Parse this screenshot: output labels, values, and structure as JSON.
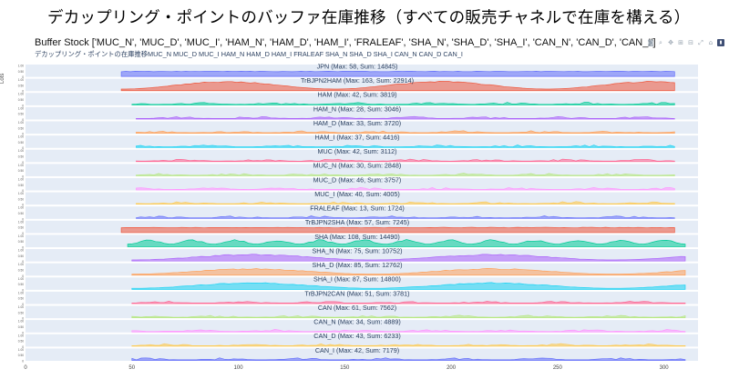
{
  "slide_title": "デカップリング・ポイントのバッファ在庫推移（すべての販売チャネルで在庫を構える）",
  "chart_title": "Buffer Stock ['MUC_N', 'MUC_D', 'MUC_I', 'HAM_N', 'HAM_D', 'HAM_I', 'FRALEAF', 'SHA_N', 'SHA_D', 'SHA_I', 'CAN_N', 'CAN_D', 'CAN_I']",
  "chart_subtitle": "デカップリング・ポイントの在庫推移MUC_N MUC_D MUC_I HAM_N HAM_D HAM_I FRALEAF SHA_N SHA_D SHA_I CAN_N CAN_D CAN_I",
  "ylabel": "Lots",
  "modebar": [
    {
      "name": "camera-icon",
      "glyph": "◙"
    },
    {
      "name": "zoom-icon",
      "glyph": "⌕"
    },
    {
      "name": "pan-icon",
      "glyph": "✥"
    },
    {
      "name": "zoom-in-icon",
      "glyph": "⊞"
    },
    {
      "name": "zoom-out-icon",
      "glyph": "⊟"
    },
    {
      "name": "autoscale-icon",
      "glyph": "⤢"
    },
    {
      "name": "home-icon",
      "glyph": "⌂"
    },
    {
      "name": "plotly-logo-icon",
      "glyph": "▮"
    }
  ],
  "chart_data": {
    "type": "area",
    "xlim": [
      0,
      316
    ],
    "x_ticks": [
      0,
      50,
      100,
      150,
      200,
      250,
      300
    ],
    "panel_ticks": [
      "1.00",
      "0.50",
      "0"
    ],
    "legend": "none",
    "grid": true,
    "series": [
      {
        "name": "JPN",
        "label": "JPN (Max: 58, Sum: 14845)",
        "max": 58,
        "sum": 14845,
        "color": "#636efa",
        "start": 45,
        "end": 305,
        "shape": "flat"
      },
      {
        "name": "TrBJPN2HAM",
        "label": "TrBJPN2HAM (Max: 163, Sum: 22914)",
        "max": 163,
        "sum": 22914,
        "color": "#ef553b",
        "start": 45,
        "end": 305,
        "shape": "hills"
      },
      {
        "name": "HAM",
        "label": "HAM (Max: 42, Sum: 3819)",
        "max": 42,
        "sum": 3819,
        "color": "#00cc96",
        "start": 50,
        "end": 305,
        "shape": "low"
      },
      {
        "name": "HAM_N",
        "label": "HAM_N (Max: 28, Sum: 3046)",
        "max": 28,
        "sum": 3046,
        "color": "#ab63fa",
        "start": 52,
        "end": 305,
        "shape": "low"
      },
      {
        "name": "HAM_D",
        "label": "HAM_D (Max: 33, Sum: 3720)",
        "max": 33,
        "sum": 3720,
        "color": "#ffa15a",
        "start": 52,
        "end": 305,
        "shape": "low"
      },
      {
        "name": "HAM_I",
        "label": "HAM_I (Max: 37, Sum: 4416)",
        "max": 37,
        "sum": 4416,
        "color": "#19d3f3",
        "start": 52,
        "end": 305,
        "shape": "low"
      },
      {
        "name": "MUC",
        "label": "MUC (Max: 42, Sum: 3112)",
        "max": 42,
        "sum": 3112,
        "color": "#ff6692",
        "start": 52,
        "end": 305,
        "shape": "low"
      },
      {
        "name": "MUC_N",
        "label": "MUC_N (Max: 30, Sum: 2848)",
        "max": 30,
        "sum": 2848,
        "color": "#b6e880",
        "start": 52,
        "end": 305,
        "shape": "low"
      },
      {
        "name": "MUC_D",
        "label": "MUC_D (Max: 46, Sum: 3757)",
        "max": 46,
        "sum": 3757,
        "color": "#ff97ff",
        "start": 52,
        "end": 305,
        "shape": "low"
      },
      {
        "name": "MUC_I",
        "label": "MUC_I (Max: 40, Sum: 4005)",
        "max": 40,
        "sum": 4005,
        "color": "#fecb52",
        "start": 52,
        "end": 305,
        "shape": "low"
      },
      {
        "name": "FRALEAF",
        "label": "FRALEAF (Max: 13, Sum: 1724)",
        "max": 13,
        "sum": 1724,
        "color": "#636efa",
        "start": 52,
        "end": 305,
        "shape": "low"
      },
      {
        "name": "TrBJPN2SHA",
        "label": "TrBJPN2SHA (Max: 57, Sum: 7245)",
        "max": 57,
        "sum": 7245,
        "color": "#ef553b",
        "start": 45,
        "end": 305,
        "shape": "flat"
      },
      {
        "name": "SHA",
        "label": "SHA (Max: 108, Sum: 14490)",
        "max": 108,
        "sum": 14490,
        "color": "#00cc96",
        "start": 48,
        "end": 310,
        "shape": "dense"
      },
      {
        "name": "SHA_N",
        "label": "SHA_N (Max: 75, Sum: 10752)",
        "max": 75,
        "sum": 10752,
        "color": "#ab63fa",
        "start": 50,
        "end": 310,
        "shape": "wave"
      },
      {
        "name": "SHA_D",
        "label": "SHA_D (Max: 85, Sum: 12762)",
        "max": 85,
        "sum": 12762,
        "color": "#ffa15a",
        "start": 50,
        "end": 310,
        "shape": "wave"
      },
      {
        "name": "SHA_I",
        "label": "SHA_I (Max: 87, Sum: 14800)",
        "max": 87,
        "sum": 14800,
        "color": "#19d3f3",
        "start": 50,
        "end": 310,
        "shape": "wave"
      },
      {
        "name": "TrBJPN2CAN",
        "label": "TrBJPN2CAN (Max: 51, Sum: 3781)",
        "max": 51,
        "sum": 3781,
        "color": "#ff6692",
        "start": 50,
        "end": 310,
        "shape": "low"
      },
      {
        "name": "CAN",
        "label": "CAN (Max: 61, Sum: 7562)",
        "max": 61,
        "sum": 7562,
        "color": "#b6e880",
        "start": 50,
        "end": 310,
        "shape": "low"
      },
      {
        "name": "CAN_N",
        "label": "CAN_N (Max: 34, Sum: 4889)",
        "max": 34,
        "sum": 4889,
        "color": "#ff97ff",
        "start": 50,
        "end": 310,
        "shape": "low"
      },
      {
        "name": "CAN_D",
        "label": "CAN_D (Max: 43, Sum: 6233)",
        "max": 43,
        "sum": 6233,
        "color": "#fecb52",
        "start": 50,
        "end": 310,
        "shape": "low"
      },
      {
        "name": "CAN_I",
        "label": "CAN_I (Max: 42, Sum: 7179)",
        "max": 42,
        "sum": 7179,
        "color": "#636efa",
        "start": 50,
        "end": 310,
        "shape": "low"
      }
    ]
  }
}
